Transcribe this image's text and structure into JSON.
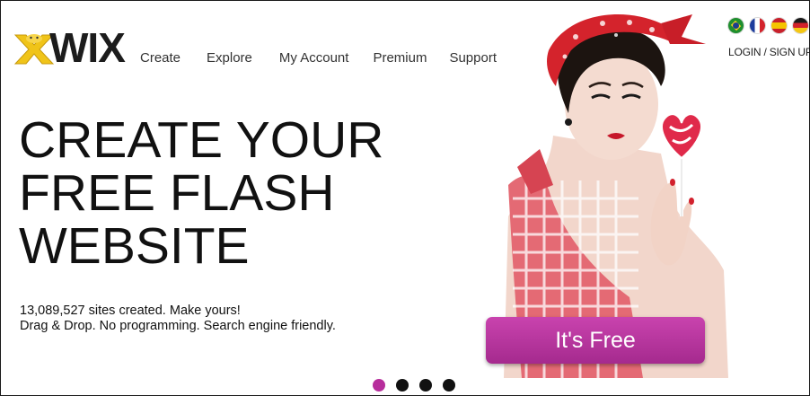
{
  "header": {
    "logo_text": "WIX",
    "nav": [
      "Create",
      "Explore",
      "My Account",
      "Premium",
      "Support"
    ],
    "login_label": "LOGIN / SIGN UP",
    "language_flags": [
      "brazil-flag-icon",
      "france-flag-icon",
      "spain-flag-icon",
      "germany-flag-icon"
    ]
  },
  "hero": {
    "headline": [
      "CREATE YOUR",
      "FREE FLASH",
      "WEBSITE"
    ],
    "stats_line": "13,089,527 sites created. Make yours!",
    "features_line": "Drag & Drop. No programming. Search engine friendly.",
    "cta_label": "It's Free",
    "image_icon": "pinup-woman-with-heart-lollipop"
  },
  "carousel": {
    "slide_count": 4,
    "active_index": 0
  },
  "colors": {
    "accent": "#b72e9c",
    "text": "#111111",
    "logo_yellow": "#f0c419"
  }
}
